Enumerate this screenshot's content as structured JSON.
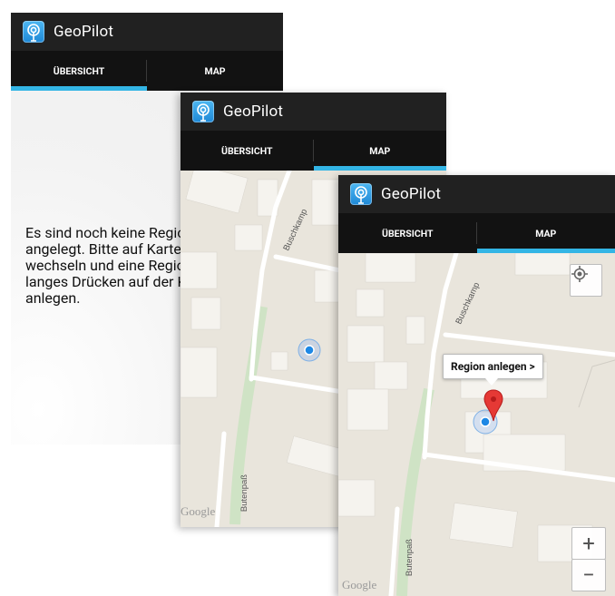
{
  "app": {
    "title": "GeoPilot"
  },
  "tabs": {
    "overview": "ÜBERSICHT",
    "map": "MAP"
  },
  "overview": {
    "message": "Es sind noch keine Regionen angelegt. Bitte auf Kartenansicht wechseln und eine Region durch langes Drücken auf der Karte anlegen."
  },
  "map": {
    "streets": {
      "buschkamp": "Buschkamp",
      "butenpass": "Butenpaß"
    },
    "attribution": "Google",
    "callout": "Region anlegen >",
    "zoom_in": "+",
    "zoom_out": "−"
  },
  "icons": {
    "app": "geopilot-app-icon",
    "location": "my-location-icon",
    "marker": "map-pin-icon",
    "position": "current-position-dot"
  },
  "colors": {
    "actionbar": "#212121",
    "tabbar": "#121212",
    "tab_indicator": "#33b5e5",
    "map_bg": "#e9e5dc",
    "marker": "#e53935",
    "location_dot": "#1e88e5"
  }
}
